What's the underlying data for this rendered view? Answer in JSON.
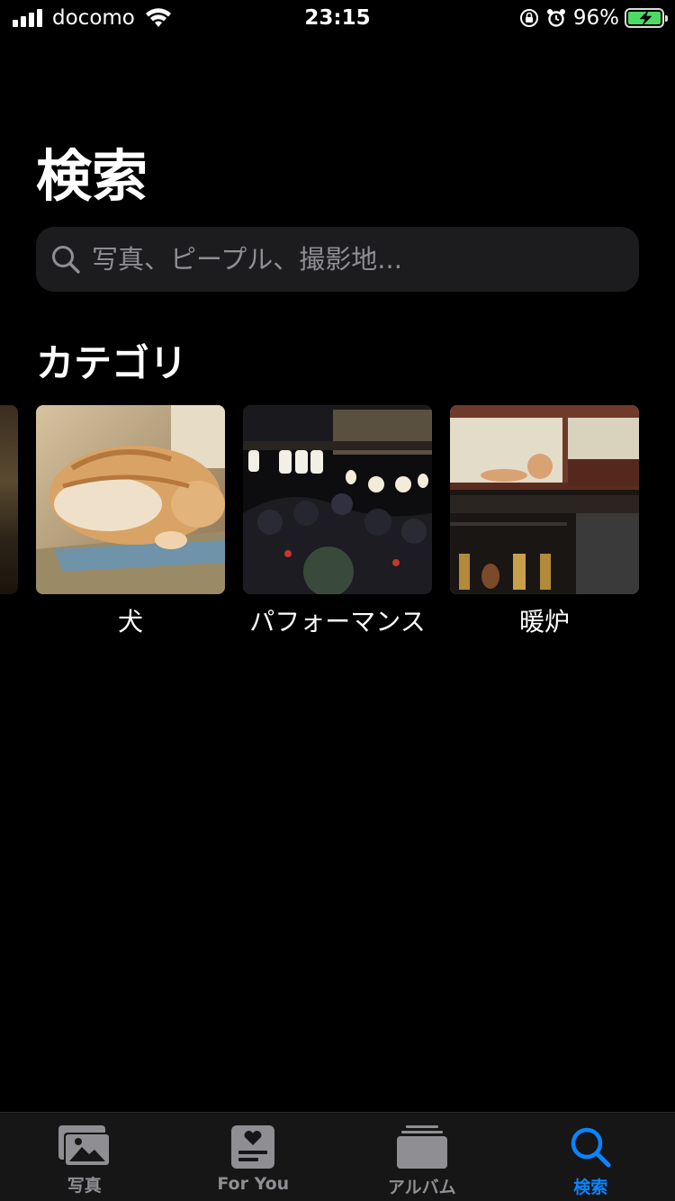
{
  "status": {
    "carrier": "docomo",
    "time": "23:15",
    "battery": "96%"
  },
  "title": "検索",
  "search": {
    "placeholder": "写真、ピープル、撮影地..."
  },
  "section_title": "カテゴリ",
  "categories": [
    {
      "label": "犬"
    },
    {
      "label": "パフォーマンス"
    },
    {
      "label": "暖炉"
    }
  ],
  "tabs": [
    {
      "label": "写真",
      "icon": "photos-icon"
    },
    {
      "label": "For You",
      "icon": "for-you-icon"
    },
    {
      "label": "アルバム",
      "icon": "albums-icon"
    },
    {
      "label": "検索",
      "icon": "search-icon",
      "active": true
    }
  ],
  "colors": {
    "accent": "#0a84ff",
    "inactive": "#8e8e93",
    "battery": "#4cd964",
    "background": "#000000"
  }
}
